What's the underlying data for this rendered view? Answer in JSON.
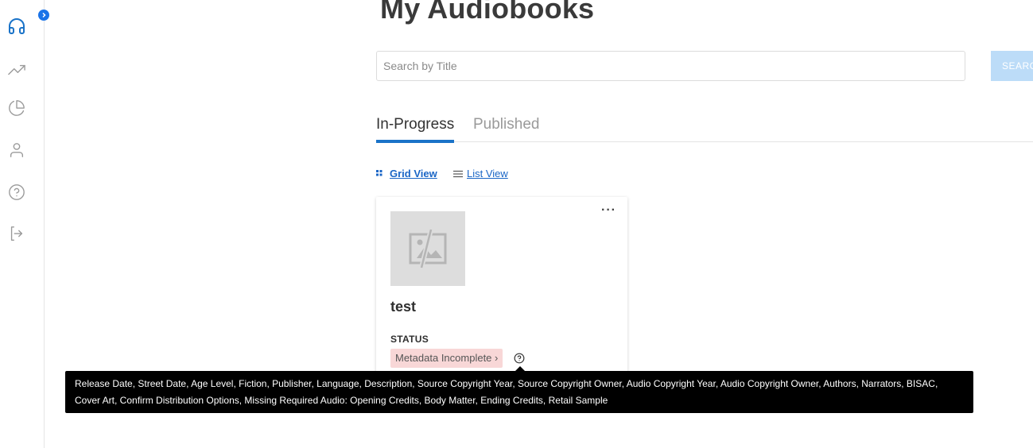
{
  "page": {
    "title": "My Audiobooks"
  },
  "search": {
    "placeholder": "Search by Title",
    "button_label": "SEARCH"
  },
  "tabs": [
    {
      "label": "In-Progress",
      "active": true
    },
    {
      "label": "Published",
      "active": false
    }
  ],
  "views": {
    "grid_label": "Grid View",
    "list_label": "List View",
    "selected": "Grid View"
  },
  "sidebar": {
    "items": [
      {
        "icon": "headphones-icon",
        "active": true
      },
      {
        "icon": "trending-up-icon",
        "active": false
      },
      {
        "icon": "pie-chart-icon",
        "active": false
      },
      {
        "icon": "user-icon",
        "active": false
      },
      {
        "icon": "help-circle-icon",
        "active": false
      },
      {
        "icon": "logout-icon",
        "active": false
      }
    ],
    "toggle_icon": "chevron-right-icon"
  },
  "cards": [
    {
      "title": "test",
      "cover_icon": "image-placeholder-icon",
      "menu_icon": "more-horizontal-icon",
      "status_label": "STATUS",
      "status_value": "Metadata Incomplete",
      "status_chevron": "›",
      "help_icon": "help-circle-icon"
    }
  ],
  "tooltip": {
    "text": "Release Date, Street Date, Age Level, Fiction, Publisher, Language, Description, Source Copyright Year, Source Copyright Owner, Audio Copyright Year, Audio Copyright Owner, Authors, Narrators, BISAC, Cover Art, Confirm Distribution Options, Missing Required Audio: Opening Credits, Body Matter, Ending Credits, Retail Sample"
  },
  "colors": {
    "accent": "#1a73c8",
    "link": "#1a66c6",
    "search_button": "#bcdcf8",
    "status_badge_bg": "#f8d7d7",
    "tooltip_bg": "#000000",
    "toggle_bg": "#1a73e8"
  }
}
